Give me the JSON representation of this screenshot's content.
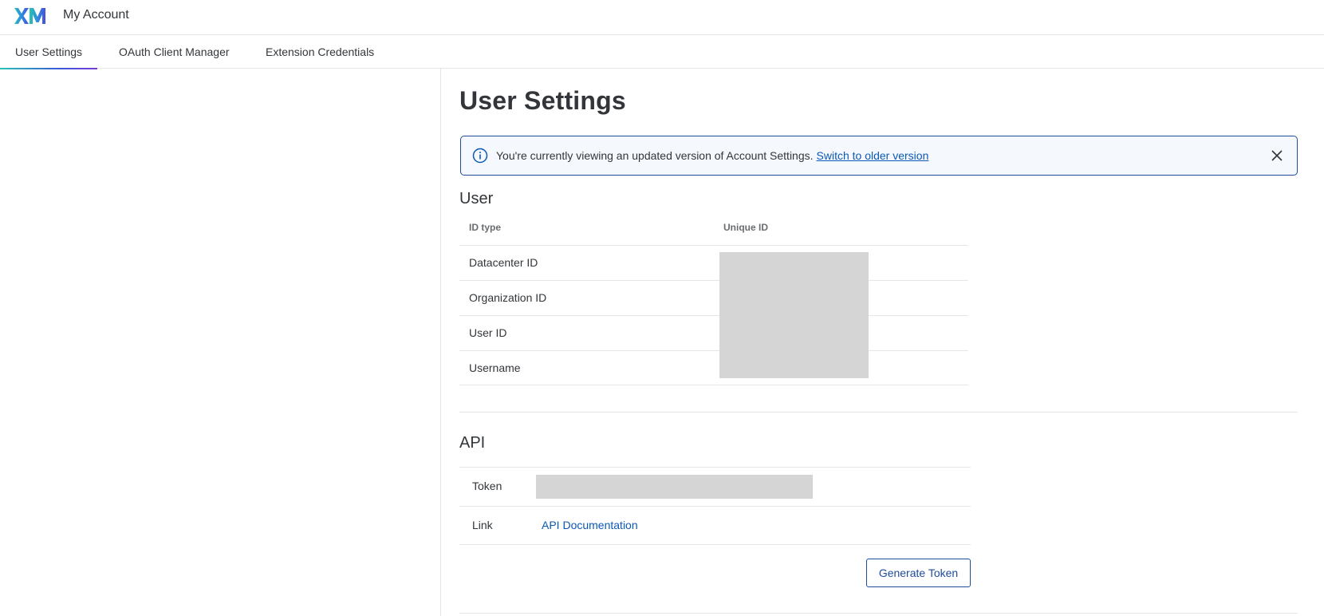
{
  "header": {
    "logo_text": "XM",
    "app_title": "My Account"
  },
  "tabs": [
    {
      "label": "User Settings",
      "active": true
    },
    {
      "label": "OAuth Client Manager",
      "active": false
    },
    {
      "label": "Extension Credentials",
      "active": false
    }
  ],
  "page": {
    "title": "User Settings"
  },
  "banner": {
    "message": "You're currently viewing an updated version of Account Settings.",
    "link_label": "Switch to older version",
    "info_icon": "info-icon",
    "close_icon": "close-icon"
  },
  "user_section": {
    "title": "User",
    "columns": [
      "ID type",
      "Unique ID"
    ],
    "rows": [
      {
        "id_type": "Datacenter ID"
      },
      {
        "id_type": "Organization ID"
      },
      {
        "id_type": "User ID"
      },
      {
        "id_type": "Username"
      }
    ]
  },
  "api_section": {
    "title": "API",
    "token_label": "Token",
    "link_label": "Link",
    "link_text": "API Documentation",
    "generate_button": "Generate Token"
  },
  "colors": {
    "accent": "#0b58b7",
    "banner_border": "#1f4b9c",
    "redaction": "#d5d5d5"
  }
}
